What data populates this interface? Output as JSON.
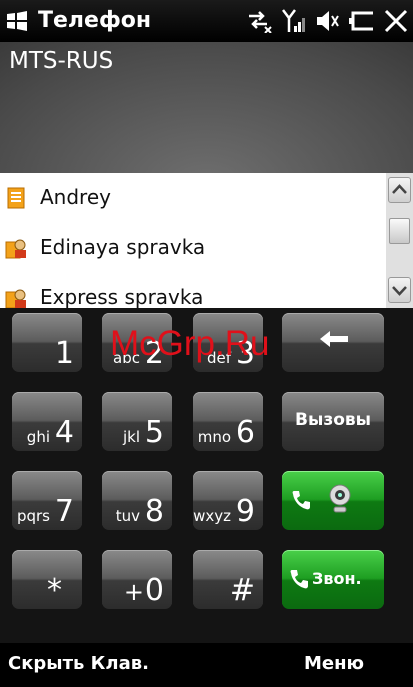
{
  "window": {
    "title": "Телефон"
  },
  "carrier": "MTS-RUS",
  "contacts": [
    {
      "name": "Andrey",
      "icon": "contact-card-icon"
    },
    {
      "name": "Edinaya spravka",
      "icon": "contact-business-icon"
    },
    {
      "name": "Express spravka",
      "icon": "contact-business-icon"
    }
  ],
  "keypad": {
    "keys": [
      {
        "digit": "1",
        "letters": ""
      },
      {
        "digit": "2",
        "letters": "abc"
      },
      {
        "digit": "3",
        "letters": "def"
      },
      {
        "digit": "4",
        "letters": "ghi"
      },
      {
        "digit": "5",
        "letters": "jkl"
      },
      {
        "digit": "6",
        "letters": "mno"
      },
      {
        "digit": "7",
        "letters": "pqrs"
      },
      {
        "digit": "8",
        "letters": "tuv"
      },
      {
        "digit": "9",
        "letters": "wxyz"
      },
      {
        "digit": "*",
        "letters": ""
      },
      {
        "digit": "0",
        "letters": "+"
      },
      {
        "digit": "#",
        "letters": ""
      }
    ],
    "backspace_icon": "backspace-arrow-icon",
    "calls_label": "Вызовы",
    "call_label": "Звон."
  },
  "watermark": "McGrp.Ru",
  "softkeys": {
    "left": "Скрыть Клав.",
    "right": "Меню"
  },
  "colors": {
    "call_green": "#1e9e22",
    "key_gray": "#5c5c5c"
  }
}
